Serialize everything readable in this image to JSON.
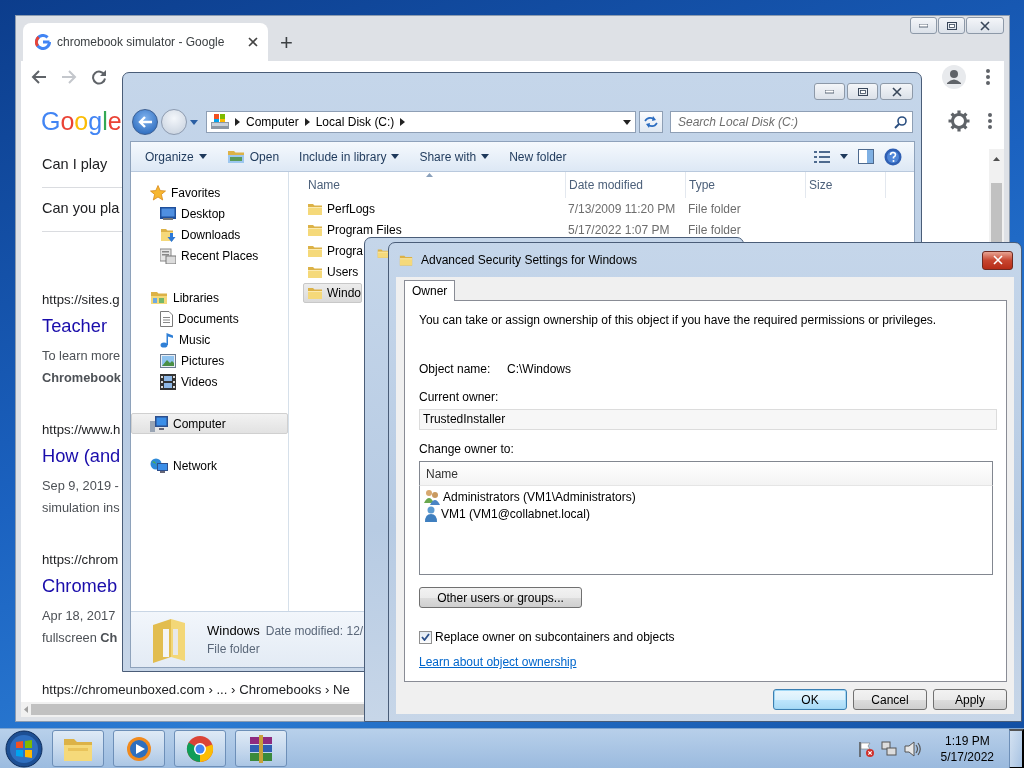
{
  "chrome": {
    "tab_title": "chromebook simulator - Google",
    "new_tab": "+",
    "back_enabled": true,
    "forward_enabled": false,
    "logo": "Google",
    "questions": [
      "Can I play",
      "Can you pla"
    ],
    "results": [
      {
        "url": "https://sites.g",
        "title": "Teacher",
        "lines": [
          "To learn more",
          "**Chromebook**"
        ]
      },
      {
        "url": "https://www.h",
        "title": "How (and",
        "lines": [
          "Sep 9, 2019 -",
          "simulation ins"
        ]
      },
      {
        "url": "https://chrom",
        "title": "Chromeb",
        "lines": [
          "Apr 18, 2017",
          "fullscreen **Ch**"
        ]
      }
    ],
    "footer_url": "https://chromeunboxed.com › ... › Chromebooks › Ne"
  },
  "explorer": {
    "breadcrumb": [
      "Computer",
      "Local Disk (C:)"
    ],
    "search": {
      "placeholder": "Search Local Disk (C:)"
    },
    "toolbar": [
      {
        "label": "Organize",
        "kind": "menu"
      },
      {
        "label": "Open",
        "kind": "icon"
      },
      {
        "label": "Include in library",
        "kind": "menu"
      },
      {
        "label": "Share with",
        "kind": "menu"
      },
      {
        "label": "New folder",
        "kind": "plain"
      }
    ],
    "nav": [
      {
        "label": "Favorites",
        "selected": false,
        "children": [
          {
            "label": "Desktop",
            "selected": false
          },
          {
            "label": "Downloads",
            "selected": false
          },
          {
            "label": "Recent Places",
            "selected": false
          }
        ]
      },
      {
        "label": "Libraries",
        "selected": false,
        "children": [
          {
            "label": "Documents",
            "selected": false
          },
          {
            "label": "Music",
            "selected": false
          },
          {
            "label": "Pictures",
            "selected": false
          },
          {
            "label": "Videos",
            "selected": false
          }
        ]
      },
      {
        "label": "Computer",
        "selected": true
      },
      {
        "label": "Network",
        "selected": false
      }
    ],
    "columns": [
      "Name",
      "Date modified",
      "Type",
      "Size"
    ],
    "files": [
      {
        "name": "PerfLogs",
        "date": "7/13/2009 11:20 PM",
        "type": "File folder",
        "selected": false
      },
      {
        "name": "Program Files",
        "date": "5/17/2022 1:07 PM",
        "type": "File folder",
        "selected": false
      },
      {
        "name": "Progra",
        "selected": false
      },
      {
        "name": "Users",
        "selected": false
      },
      {
        "name": "Windo",
        "selected": true
      }
    ],
    "details": {
      "name": "Windows",
      "meta": "Date modified: 12/",
      "type": "File folder"
    }
  },
  "dialog": {
    "title": "Advanced Security Settings for Windows",
    "tabs": [
      {
        "label": "Owner",
        "selected": true
      }
    ],
    "intro": "You can take or assign ownership of this object if you have the required permissions or privileges.",
    "object_name_label": "Object name:",
    "object_name": "C:\\Windows",
    "current_owner_label": "Current owner:",
    "current_owner": "TrustedInstaller",
    "change_owner_label": "Change owner to:",
    "owners_header": "Name",
    "owners": [
      {
        "name": "Administrators (VM1\\Administrators)",
        "selected": false
      },
      {
        "name": "VM1 (VM1@collabnet.local)",
        "selected": false
      }
    ],
    "other_button": "Other users or groups...",
    "replace": {
      "label": "Replace owner on subcontainers and objects",
      "checked": true
    },
    "link": "Learn about object ownership",
    "buttons": [
      {
        "label": "OK",
        "default": true
      },
      {
        "label": "Cancel",
        "default": false
      },
      {
        "label": "Apply",
        "default": false
      }
    ]
  },
  "taskbar": {
    "time": "1:19 PM",
    "date": "5/17/2022"
  }
}
